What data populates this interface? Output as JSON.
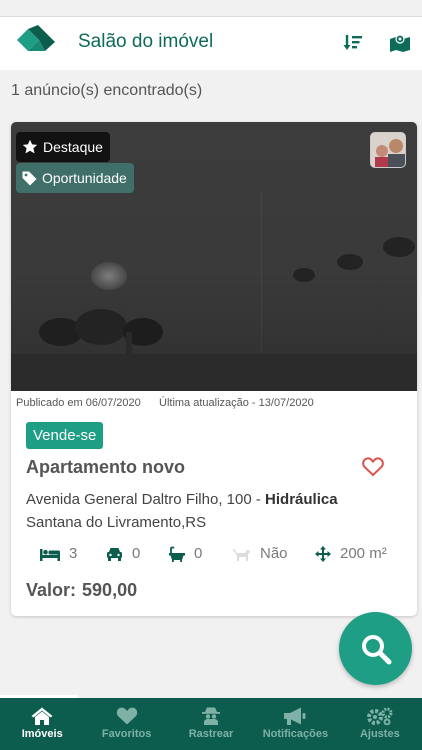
{
  "app": {
    "title": "Salão do imóvel"
  },
  "header": {
    "sort_icon": "sort-icon",
    "map_icon": "map-icon"
  },
  "results": {
    "count_text": "1 anúncio(s) encontrado(s)"
  },
  "listing": {
    "badges": {
      "highlight": "Destaque",
      "opportunity": "Oportunidade"
    },
    "published": "Publicado em 06/07/2020",
    "updated": "Última atualização - 13/07/2020",
    "tag": "Vende-se",
    "title": "Apartamento novo",
    "address_street": "Avenida General Daltro Filho, 100 - ",
    "address_district": "Hidráulica",
    "address_city": "Santana do Livramento,RS",
    "features": {
      "bedrooms": "3",
      "garages": "0",
      "bathrooms": "0",
      "pets": "Não",
      "area": "200 m²"
    },
    "price_label": "Valor:",
    "price_value": "590,00"
  },
  "nav": {
    "items": [
      {
        "label": "Imóveis",
        "icon": "home-icon"
      },
      {
        "label": "Favoritos",
        "icon": "heart-icon"
      },
      {
        "label": "Rastrear",
        "icon": "spy-icon"
      },
      {
        "label": "Notificações",
        "icon": "megaphone-icon"
      },
      {
        "label": "Ajustes",
        "icon": "gears-icon"
      }
    ]
  },
  "colors": {
    "primary": "#0d5d4e",
    "accent": "#1e9e85",
    "title": "#0d6b5a",
    "heart": "#d9534f"
  }
}
